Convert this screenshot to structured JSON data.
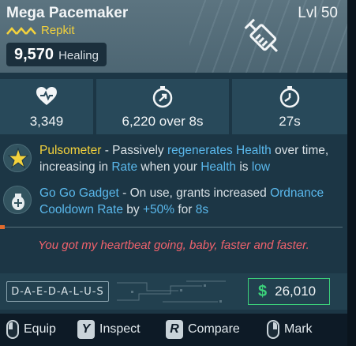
{
  "item": {
    "name": "Mega Pacemaker",
    "level": "Lvl 50",
    "rarity": "Repkit",
    "healing_value": "9,570",
    "healing_unit": "Healing"
  },
  "stats": {
    "health": "3,349",
    "duration": "6,220 over 8s",
    "cooldown": "27s"
  },
  "perk1": {
    "name": "Pulsometer",
    "t1": " - Passively ",
    "k1": "regenerates Health",
    "t2": " over time, increasing in ",
    "k2": "Rate",
    "t3": " when your ",
    "k3": "Health",
    "t4": " is ",
    "k4": "low"
  },
  "perk2": {
    "name": "Go Go Gadget",
    "t1": " - On use, grants increased ",
    "k1": "Ordnance Cooldown Rate",
    "t2": " by ",
    "k2": "+50%",
    "t3": " for ",
    "k3": "8s"
  },
  "flavor_text": "You got my heartbeat going, baby, faster and faster.",
  "manufacturer": "D-A-E-D-A-L-U-S",
  "price": {
    "symbol": "$",
    "amount": "26,010"
  },
  "actions": {
    "equip": "Equip",
    "inspect_key": "Y",
    "inspect": "Inspect",
    "compare_key": "R",
    "compare": "Compare",
    "mark": "Mark"
  },
  "colors": {
    "rarity": "#f3d23c",
    "keyword": "#5ab8ec",
    "flavor": "#f0626c",
    "price": "#3cd27b"
  }
}
